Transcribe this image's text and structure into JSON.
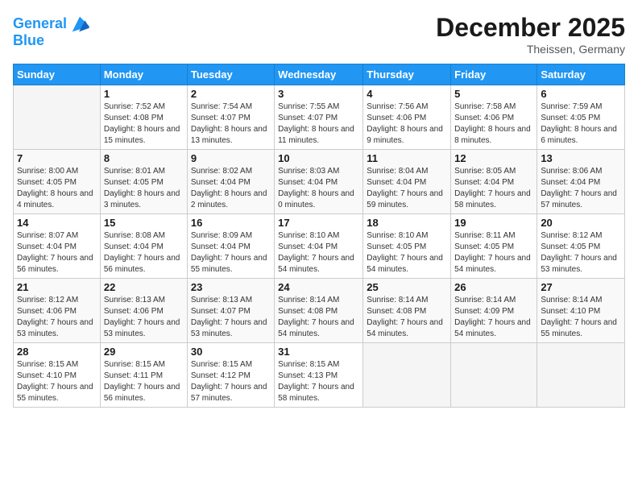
{
  "header": {
    "logo_line1": "General",
    "logo_line2": "Blue",
    "month_title": "December 2025",
    "subtitle": "Theissen, Germany"
  },
  "days_of_week": [
    "Sunday",
    "Monday",
    "Tuesday",
    "Wednesday",
    "Thursday",
    "Friday",
    "Saturday"
  ],
  "weeks": [
    [
      {
        "day": "",
        "sunrise": "",
        "sunset": "",
        "daylight": ""
      },
      {
        "day": "1",
        "sunrise": "Sunrise: 7:52 AM",
        "sunset": "Sunset: 4:08 PM",
        "daylight": "Daylight: 8 hours and 15 minutes."
      },
      {
        "day": "2",
        "sunrise": "Sunrise: 7:54 AM",
        "sunset": "Sunset: 4:07 PM",
        "daylight": "Daylight: 8 hours and 13 minutes."
      },
      {
        "day": "3",
        "sunrise": "Sunrise: 7:55 AM",
        "sunset": "Sunset: 4:07 PM",
        "daylight": "Daylight: 8 hours and 11 minutes."
      },
      {
        "day": "4",
        "sunrise": "Sunrise: 7:56 AM",
        "sunset": "Sunset: 4:06 PM",
        "daylight": "Daylight: 8 hours and 9 minutes."
      },
      {
        "day": "5",
        "sunrise": "Sunrise: 7:58 AM",
        "sunset": "Sunset: 4:06 PM",
        "daylight": "Daylight: 8 hours and 8 minutes."
      },
      {
        "day": "6",
        "sunrise": "Sunrise: 7:59 AM",
        "sunset": "Sunset: 4:05 PM",
        "daylight": "Daylight: 8 hours and 6 minutes."
      }
    ],
    [
      {
        "day": "7",
        "sunrise": "Sunrise: 8:00 AM",
        "sunset": "Sunset: 4:05 PM",
        "daylight": "Daylight: 8 hours and 4 minutes."
      },
      {
        "day": "8",
        "sunrise": "Sunrise: 8:01 AM",
        "sunset": "Sunset: 4:05 PM",
        "daylight": "Daylight: 8 hours and 3 minutes."
      },
      {
        "day": "9",
        "sunrise": "Sunrise: 8:02 AM",
        "sunset": "Sunset: 4:04 PM",
        "daylight": "Daylight: 8 hours and 2 minutes."
      },
      {
        "day": "10",
        "sunrise": "Sunrise: 8:03 AM",
        "sunset": "Sunset: 4:04 PM",
        "daylight": "Daylight: 8 hours and 0 minutes."
      },
      {
        "day": "11",
        "sunrise": "Sunrise: 8:04 AM",
        "sunset": "Sunset: 4:04 PM",
        "daylight": "Daylight: 7 hours and 59 minutes."
      },
      {
        "day": "12",
        "sunrise": "Sunrise: 8:05 AM",
        "sunset": "Sunset: 4:04 PM",
        "daylight": "Daylight: 7 hours and 58 minutes."
      },
      {
        "day": "13",
        "sunrise": "Sunrise: 8:06 AM",
        "sunset": "Sunset: 4:04 PM",
        "daylight": "Daylight: 7 hours and 57 minutes."
      }
    ],
    [
      {
        "day": "14",
        "sunrise": "Sunrise: 8:07 AM",
        "sunset": "Sunset: 4:04 PM",
        "daylight": "Daylight: 7 hours and 56 minutes."
      },
      {
        "day": "15",
        "sunrise": "Sunrise: 8:08 AM",
        "sunset": "Sunset: 4:04 PM",
        "daylight": "Daylight: 7 hours and 56 minutes."
      },
      {
        "day": "16",
        "sunrise": "Sunrise: 8:09 AM",
        "sunset": "Sunset: 4:04 PM",
        "daylight": "Daylight: 7 hours and 55 minutes."
      },
      {
        "day": "17",
        "sunrise": "Sunrise: 8:10 AM",
        "sunset": "Sunset: 4:04 PM",
        "daylight": "Daylight: 7 hours and 54 minutes."
      },
      {
        "day": "18",
        "sunrise": "Sunrise: 8:10 AM",
        "sunset": "Sunset: 4:05 PM",
        "daylight": "Daylight: 7 hours and 54 minutes."
      },
      {
        "day": "19",
        "sunrise": "Sunrise: 8:11 AM",
        "sunset": "Sunset: 4:05 PM",
        "daylight": "Daylight: 7 hours and 54 minutes."
      },
      {
        "day": "20",
        "sunrise": "Sunrise: 8:12 AM",
        "sunset": "Sunset: 4:05 PM",
        "daylight": "Daylight: 7 hours and 53 minutes."
      }
    ],
    [
      {
        "day": "21",
        "sunrise": "Sunrise: 8:12 AM",
        "sunset": "Sunset: 4:06 PM",
        "daylight": "Daylight: 7 hours and 53 minutes."
      },
      {
        "day": "22",
        "sunrise": "Sunrise: 8:13 AM",
        "sunset": "Sunset: 4:06 PM",
        "daylight": "Daylight: 7 hours and 53 minutes."
      },
      {
        "day": "23",
        "sunrise": "Sunrise: 8:13 AM",
        "sunset": "Sunset: 4:07 PM",
        "daylight": "Daylight: 7 hours and 53 minutes."
      },
      {
        "day": "24",
        "sunrise": "Sunrise: 8:14 AM",
        "sunset": "Sunset: 4:08 PM",
        "daylight": "Daylight: 7 hours and 54 minutes."
      },
      {
        "day": "25",
        "sunrise": "Sunrise: 8:14 AM",
        "sunset": "Sunset: 4:08 PM",
        "daylight": "Daylight: 7 hours and 54 minutes."
      },
      {
        "day": "26",
        "sunrise": "Sunrise: 8:14 AM",
        "sunset": "Sunset: 4:09 PM",
        "daylight": "Daylight: 7 hours and 54 minutes."
      },
      {
        "day": "27",
        "sunrise": "Sunrise: 8:14 AM",
        "sunset": "Sunset: 4:10 PM",
        "daylight": "Daylight: 7 hours and 55 minutes."
      }
    ],
    [
      {
        "day": "28",
        "sunrise": "Sunrise: 8:15 AM",
        "sunset": "Sunset: 4:10 PM",
        "daylight": "Daylight: 7 hours and 55 minutes."
      },
      {
        "day": "29",
        "sunrise": "Sunrise: 8:15 AM",
        "sunset": "Sunset: 4:11 PM",
        "daylight": "Daylight: 7 hours and 56 minutes."
      },
      {
        "day": "30",
        "sunrise": "Sunrise: 8:15 AM",
        "sunset": "Sunset: 4:12 PM",
        "daylight": "Daylight: 7 hours and 57 minutes."
      },
      {
        "day": "31",
        "sunrise": "Sunrise: 8:15 AM",
        "sunset": "Sunset: 4:13 PM",
        "daylight": "Daylight: 7 hours and 58 minutes."
      },
      {
        "day": "",
        "sunrise": "",
        "sunset": "",
        "daylight": ""
      },
      {
        "day": "",
        "sunrise": "",
        "sunset": "",
        "daylight": ""
      },
      {
        "day": "",
        "sunrise": "",
        "sunset": "",
        "daylight": ""
      }
    ]
  ]
}
